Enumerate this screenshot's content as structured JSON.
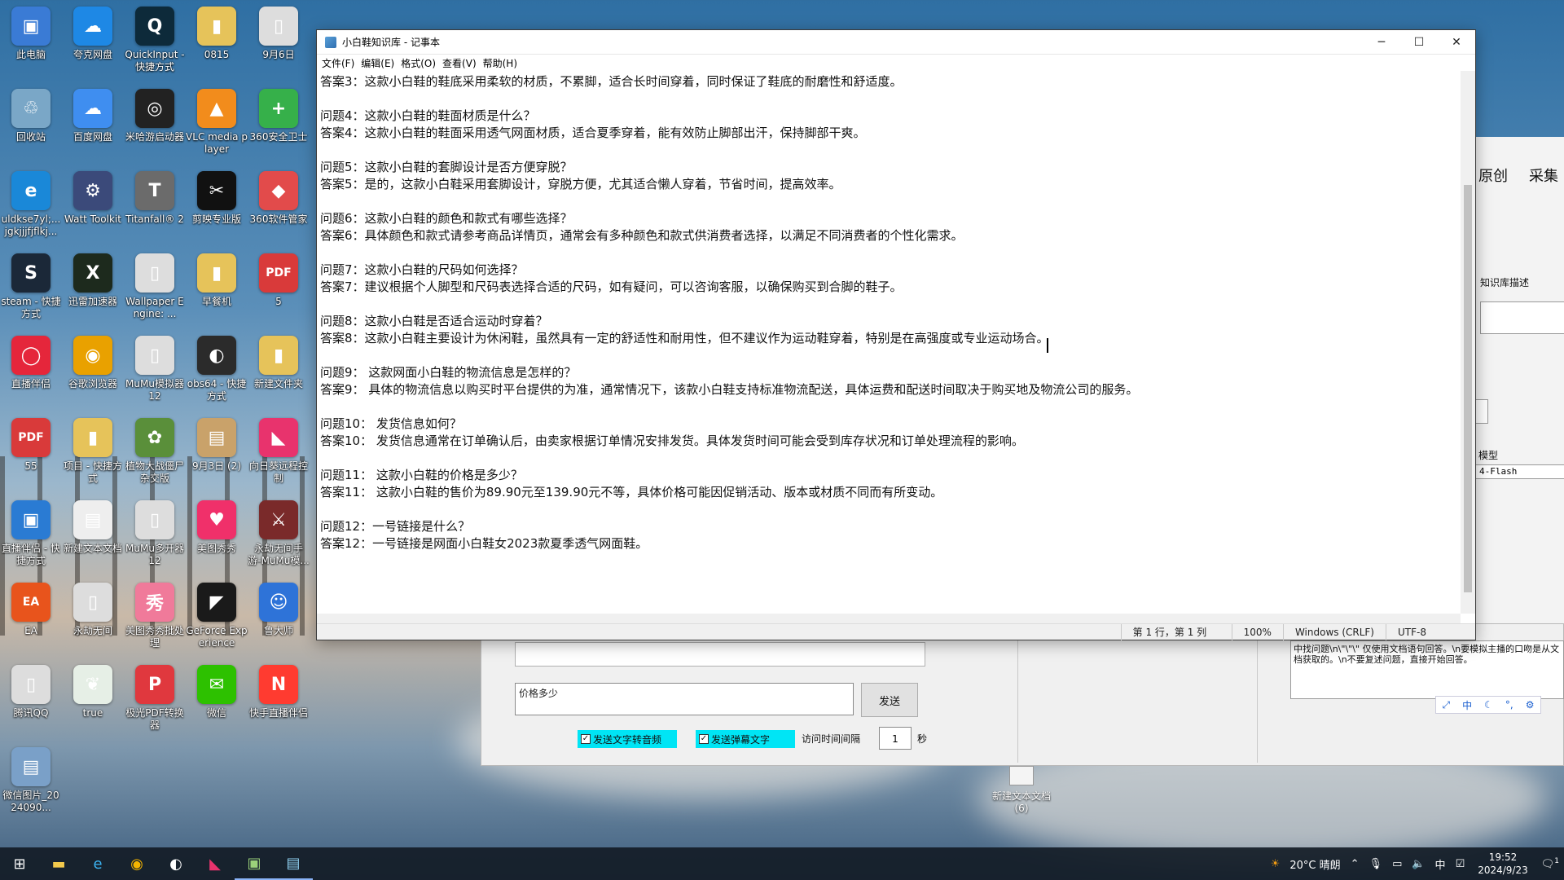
{
  "desktop": {
    "icons": [
      {
        "label": "此电脑",
        "glyph": "▣",
        "color": "#3a7bd5"
      },
      {
        "label": "夸克网盘",
        "glyph": "☁",
        "color": "#1e88e5"
      },
      {
        "label": "QuickInput - 快捷方式",
        "glyph": "Q",
        "color": "#0d2a3a"
      },
      {
        "label": "0815",
        "glyph": "▮",
        "color": "#e6c35a"
      },
      {
        "label": "9月6日",
        "glyph": "▯",
        "color": "#dddddd"
      },
      {
        "label": "回收站",
        "glyph": "♲",
        "color": "#7aa7c7"
      },
      {
        "label": "百度网盘",
        "glyph": "☁",
        "color": "#3f8ef0"
      },
      {
        "label": "米哈游启动器",
        "glyph": "◎",
        "color": "#222222"
      },
      {
        "label": "VLC media player",
        "glyph": "▲",
        "color": "#f28c1c"
      },
      {
        "label": "360安全卫士",
        "glyph": "+",
        "color": "#36b04a"
      },
      {
        "label": "uldkse7yl;...jgkjjjfjflkj...",
        "glyph": "e",
        "color": "#1a88d8"
      },
      {
        "label": "Watt Toolkit",
        "glyph": "⚙",
        "color": "#3b4a7a"
      },
      {
        "label": "Titanfall® 2",
        "glyph": "T",
        "color": "#6b6b6b"
      },
      {
        "label": "剪映专业版",
        "glyph": "✂",
        "color": "#111111"
      },
      {
        "label": "360软件管家",
        "glyph": "◆",
        "color": "#e24b4b"
      },
      {
        "label": "steam - 快捷方式",
        "glyph": "S",
        "color": "#1b2838"
      },
      {
        "label": "迅雷加速器",
        "glyph": "X",
        "color": "#1d2a1d"
      },
      {
        "label": "Wallpaper Engine: ...",
        "glyph": "▯",
        "color": "#dddddd"
      },
      {
        "label": "早餐机",
        "glyph": "▮",
        "color": "#e6c35a"
      },
      {
        "label": "5",
        "glyph": "PDF",
        "color": "#d93a3a"
      },
      {
        "label": "直播伴侣",
        "glyph": "◯",
        "color": "#e5263b"
      },
      {
        "label": "谷歌浏览器",
        "glyph": "◉",
        "color": "#e9a100"
      },
      {
        "label": "MuMu模拟器12",
        "glyph": "▯",
        "color": "#dddddd"
      },
      {
        "label": "obs64 - 快捷方式",
        "glyph": "◐",
        "color": "#2b2b2b"
      },
      {
        "label": "新建文件夹",
        "glyph": "▮",
        "color": "#e6c35a"
      },
      {
        "label": "55",
        "glyph": "PDF",
        "color": "#d93a3a"
      },
      {
        "label": "项目 - 快捷方式",
        "glyph": "▮",
        "color": "#e6c35a"
      },
      {
        "label": "植物大战僵尸杂交版",
        "glyph": "✿",
        "color": "#5a8f3a"
      },
      {
        "label": "9月3日 (2)",
        "glyph": "▤",
        "color": "#c9a26a"
      },
      {
        "label": "向日葵远程控制",
        "glyph": "◣",
        "color": "#e8336d"
      },
      {
        "label": "直播伴侣 - 快捷方式",
        "glyph": "▣",
        "color": "#2a7bd3"
      },
      {
        "label": "新建文本文档",
        "glyph": "▤",
        "color": "#eeeeee"
      },
      {
        "label": "MuMu多开器12",
        "glyph": "▯",
        "color": "#dddddd"
      },
      {
        "label": "美图秀秀",
        "glyph": "♥",
        "color": "#f0306a"
      },
      {
        "label": "永劫无间手游-MuMu模...",
        "glyph": "⚔",
        "color": "#7a2a2a"
      },
      {
        "label": "EA",
        "glyph": "EA",
        "color": "#e8541c"
      },
      {
        "label": "永劫无间",
        "glyph": "▯",
        "color": "#dddddd"
      },
      {
        "label": "美图秀秀批处理",
        "glyph": "秀",
        "color": "#f07a9a"
      },
      {
        "label": "GeForce Experience",
        "glyph": "◤",
        "color": "#1a1a1a"
      },
      {
        "label": "鲁大师",
        "glyph": "☺",
        "color": "#2e73d8"
      },
      {
        "label": "腾讯QQ",
        "glyph": "▯",
        "color": "#dddddd"
      },
      {
        "label": "true",
        "glyph": "❦",
        "color": "#e6efe6"
      },
      {
        "label": "极光PDF转换器",
        "glyph": "P",
        "color": "#e0383e"
      },
      {
        "label": "微信",
        "glyph": "✉",
        "color": "#2dc100"
      },
      {
        "label": "快手直播伴侣",
        "glyph": "N",
        "color": "#ff3b30"
      },
      {
        "label": "微信图片_2024090...",
        "glyph": "▤",
        "color": "#7aa0c8"
      }
    ],
    "file_icon_label": "新建文本文档 (6)"
  },
  "notepad": {
    "title": "小白鞋知识库 - 记事本",
    "menu": [
      "文件(F)",
      "编辑(E)",
      "格式(O)",
      "查看(V)",
      "帮助(H)"
    ],
    "lines": [
      "答案3：这款小白鞋的鞋底采用柔软的材质，不累脚，适合长时间穿着，同时保证了鞋底的耐磨性和舒适度。",
      "",
      "问题4：这款小白鞋的鞋面材质是什么？",
      "答案4：这款小白鞋的鞋面采用透气网面材质，适合夏季穿着，能有效防止脚部出汗，保持脚部干爽。",
      "",
      "问题5：这款小白鞋的套脚设计是否方便穿脱？",
      "答案5：是的，这款小白鞋采用套脚设计，穿脱方便，尤其适合懒人穿着，节省时间，提高效率。",
      "",
      "问题6：这款小白鞋的颜色和款式有哪些选择？",
      "答案6：具体颜色和款式请参考商品详情页，通常会有多种颜色和款式供消费者选择，以满足不同消费者的个性化需求。",
      "",
      "问题7：这款小白鞋的尺码如何选择？",
      "答案7：建议根据个人脚型和尺码表选择合适的尺码，如有疑问，可以咨询客服，以确保购买到合脚的鞋子。",
      "",
      "问题8：这款小白鞋是否适合运动时穿着？",
      "答案8：这款小白鞋主要设计为休闲鞋，虽然具有一定的舒适性和耐用性，但不建议作为运动鞋穿着，特别是在高强度或专业运动场合。",
      "",
      "问题9： 这款网面小白鞋的物流信息是怎样的？",
      "答案9： 具体的物流信息以购买时平台提供的为准，通常情况下，该款小白鞋支持标准物流配送，具体运费和配送时间取决于购买地及物流公司的服务。",
      "",
      "问题10： 发货信息如何？",
      "答案10： 发货信息通常在订单确认后，由卖家根据订单情况安排发货。具体发货时间可能会受到库存状况和订单处理流程的影响。",
      "",
      "问题11： 这款小白鞋的价格是多少？",
      "答案11： 这款小白鞋的售价为89.90元至139.90元不等，具体价格可能因促销活动、版本或材质不同而有所变动。",
      "",
      "问题12：一号链接是什么？",
      "答案12：一号链接是网面小白鞋女2023款夏季透气网面鞋。"
    ],
    "status": {
      "position": "第 1 行，第 1 列",
      "zoom": "100%",
      "eol": "Windows (CRLF)",
      "encoding": "UTF-8"
    }
  },
  "chat_app": {
    "input_value": "价格多少",
    "send_label": "发送",
    "checkbox_tts": "发送文字转音频",
    "checkbox_danmaku": "发送弹幕文字",
    "interval_label": "访问时间间隔",
    "interval_value": "1",
    "interval_unit": "秒",
    "side_tabs": [
      "原创",
      "采集"
    ],
    "kb_desc_label": "知识库描述",
    "model_label": "模型",
    "model_value": "4-Flash",
    "right_text": "中找问题\\n\\\"\\\"\\\" 仅使用文档语句回答。\\n要模拟主播的口吻是从文档获取的。\\n不要复述问题，直接开始回答。"
  },
  "taskbar": {
    "weather": "20°C 晴朗",
    "ime": "中",
    "time": "19:52",
    "date": "2024/9/23",
    "notification_count": "1"
  }
}
